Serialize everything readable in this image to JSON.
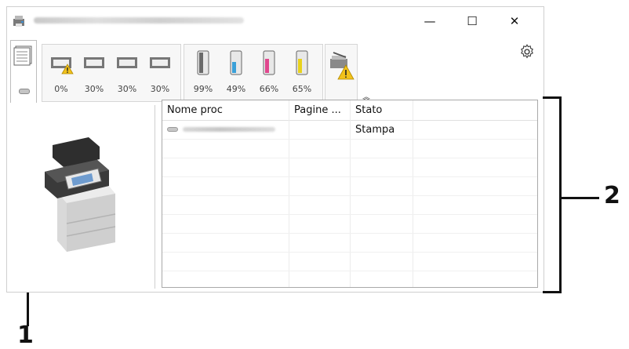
{
  "window": {
    "controls": {
      "minimize": "—",
      "maximize": "☐",
      "close": "✕"
    }
  },
  "toolbar": {
    "paper_trays": [
      {
        "level_pct": "0%",
        "warning": true
      },
      {
        "level_pct": "30%",
        "warning": false
      },
      {
        "level_pct": "30%",
        "warning": false
      },
      {
        "level_pct": "30%",
        "warning": false
      }
    ],
    "toners": [
      {
        "level_pct": "99%",
        "color": "#6b6b6b"
      },
      {
        "level_pct": "49%",
        "color": "#3aa0d8"
      },
      {
        "level_pct": "66%",
        "color": "#e0488e"
      },
      {
        "level_pct": "65%",
        "color": "#e8d21c"
      }
    ],
    "collapse_symbol": "︽",
    "icons": [
      "document-stack-icon",
      "tray-icon",
      "toner-icon",
      "scanner-warning-icon",
      "gear-icon"
    ]
  },
  "job_list": {
    "columns": [
      "Nome proc",
      "Pagine ...",
      "Stato"
    ],
    "rows": [
      {
        "pages": "",
        "status": "Stampa"
      }
    ]
  },
  "callouts": {
    "one": "1",
    "two": "2"
  },
  "colors": {
    "warning": "#f2c21b",
    "border": "#a9a9a9"
  }
}
